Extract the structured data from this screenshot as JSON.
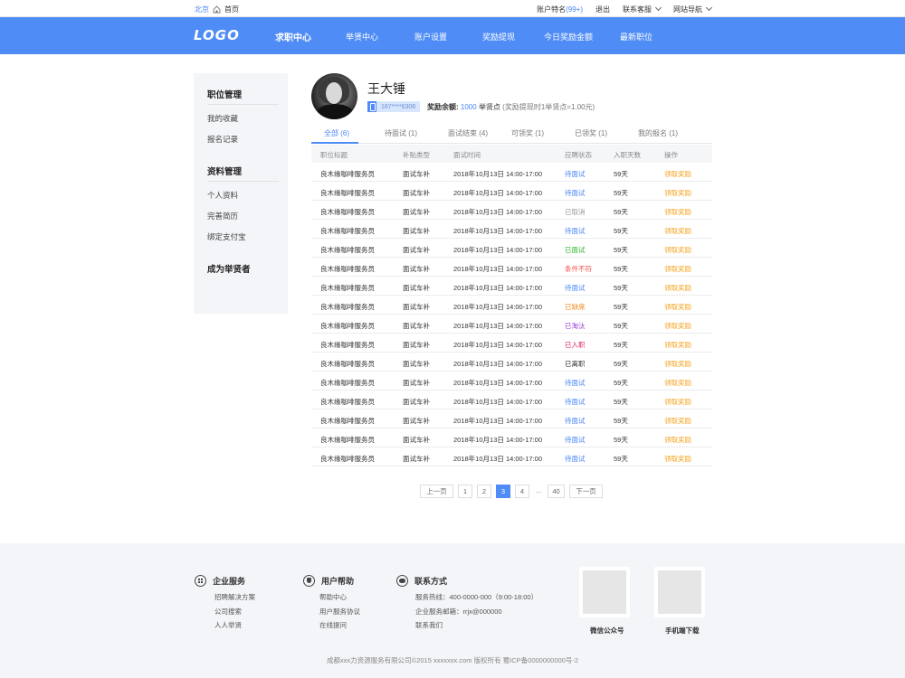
{
  "topbar": {
    "city": "北京",
    "home": "首页",
    "account": "账户特名",
    "badge": "(99+)",
    "logout": "退出",
    "service": "联系客服",
    "site_nav": "网站导航"
  },
  "nav": {
    "logo": "LOGO",
    "items": [
      "求职中心",
      "举贤中心",
      "账户设置",
      "奖励提现",
      "今日奖励金额",
      "最新职位"
    ]
  },
  "sidebar": {
    "group1": "职位管理",
    "g1_items": [
      "我的收藏",
      "报名记录"
    ],
    "group2": "资料管理",
    "g2_items": [
      "个人资料",
      "完善简历",
      "绑定支付宝"
    ],
    "group3": "成为举贤者"
  },
  "profile": {
    "name": "王大锤",
    "phone": "187****6308",
    "reward_label": "奖励余额:",
    "reward_amount": "1000",
    "reward_unit": "举贤点",
    "reward_note": "(奖励提现时1举贤点=1.00元)"
  },
  "tabs": [
    "全部 (6)",
    "待面试 (1)",
    "面试结束 (4)",
    "可领奖 (1)",
    "已领奖 (1)",
    "我的报名 (1)"
  ],
  "table": {
    "headers": [
      "职位标题",
      "补贴类型",
      "面试时间",
      "应聘状态",
      "入职天数",
      "操作"
    ],
    "rows": [
      {
        "title": "良木缘咖啡服务员",
        "type": "面试车补",
        "time": "2018年10月13日 14:00-17:00",
        "status": "待面试",
        "days": "59天",
        "op": "领取奖励"
      },
      {
        "title": "良木缘咖啡服务员",
        "type": "面试车补",
        "time": "2018年10月13日 14:00-17:00",
        "status": "待面试",
        "days": "59天",
        "op": "领取奖励"
      },
      {
        "title": "良木缘咖啡服务员",
        "type": "面试车补",
        "time": "2018年10月13日 14:00-17:00",
        "status": "已取消",
        "days": "59天",
        "op": "领取奖励"
      },
      {
        "title": "良木缘咖啡服务员",
        "type": "面试车补",
        "time": "2018年10月13日 14:00-17:00",
        "status": "待面试",
        "days": "59天",
        "op": "领取奖励"
      },
      {
        "title": "良木缘咖啡服务员",
        "type": "面试车补",
        "time": "2018年10月13日 14:00-17:00",
        "status": "已面试",
        "days": "59天",
        "op": "领取奖励"
      },
      {
        "title": "良木缘咖啡服务员",
        "type": "面试车补",
        "time": "2018年10月13日 14:00-17:00",
        "status": "条件不符",
        "days": "59天",
        "op": "领取奖励"
      },
      {
        "title": "良木缘咖啡服务员",
        "type": "面试车补",
        "time": "2018年10月13日 14:00-17:00",
        "status": "待面试",
        "days": "59天",
        "op": "领取奖励"
      },
      {
        "title": "良木缘咖啡服务员",
        "type": "面试车补",
        "time": "2018年10月13日 14:00-17:00",
        "status": "已缺席",
        "days": "59天",
        "op": "领取奖励"
      },
      {
        "title": "良木缘咖啡服务员",
        "type": "面试车补",
        "time": "2018年10月13日 14:00-17:00",
        "status": "已淘汰",
        "days": "59天",
        "op": "领取奖励"
      },
      {
        "title": "良木缘咖啡服务员",
        "type": "面试车补",
        "time": "2018年10月13日 14:00-17:00",
        "status": "已入职",
        "days": "59天",
        "op": "领取奖励"
      },
      {
        "title": "良木缘咖啡服务员",
        "type": "面试车补",
        "time": "2018年10月13日 14:00-17:00",
        "status": "已离职",
        "days": "59天",
        "op": "领取奖励"
      },
      {
        "title": "良木缘咖啡服务员",
        "type": "面试车补",
        "time": "2018年10月13日 14:00-17:00",
        "status": "待面试",
        "days": "59天",
        "op": "领取奖励"
      },
      {
        "title": "良木缘咖啡服务员",
        "type": "面试车补",
        "time": "2018年10月13日 14:00-17:00",
        "status": "待面试",
        "days": "59天",
        "op": "领取奖励"
      },
      {
        "title": "良木缘咖啡服务员",
        "type": "面试车补",
        "time": "2018年10月13日 14:00-17:00",
        "status": "待面试",
        "days": "59天",
        "op": "领取奖励"
      },
      {
        "title": "良木缘咖啡服务员",
        "type": "面试车补",
        "time": "2018年10月13日 14:00-17:00",
        "status": "待面试",
        "days": "59天",
        "op": "领取奖励"
      },
      {
        "title": "良木缘咖啡服务员",
        "type": "面试车补",
        "time": "2018年10月13日 14:00-17:00",
        "status": "待面试",
        "days": "59天",
        "op": "领取奖励"
      }
    ],
    "status_colors": {
      "待面试": "#4a86f5",
      "已取消": "#999999",
      "已面试": "#2db82d",
      "条件不符": "#f05050",
      "已缺席": "#f08a1a",
      "已淘汰": "#9a3fd6",
      "已入职": "#e0206a",
      "已离职": "#333333"
    }
  },
  "pager": {
    "prev": "上一页",
    "pages": [
      "1",
      "2",
      "3",
      "4"
    ],
    "current": "3",
    "dots": "...",
    "last": "40",
    "next": "下一页"
  },
  "footer": {
    "col1": {
      "title": "企业服务",
      "links": [
        "招聘解决方案",
        "公司搜索",
        "人人举贤"
      ]
    },
    "col2": {
      "title": "用户帮助",
      "links": [
        "帮助中心",
        "用户服务协议",
        "在线提问"
      ]
    },
    "col3": {
      "title": "联系方式",
      "links": [
        "服务热线：400-0000-000（9:00-18:00）",
        "企业服务邮箱：rrjx@000000",
        "联系我们"
      ]
    },
    "qr1": "微信公众号",
    "qr2": "手机端下载",
    "copyright": "成都xxx力资源服务有限公司©2015 xxxxxxx.com    版权所有    蜀ICP备0000000000号-2"
  }
}
